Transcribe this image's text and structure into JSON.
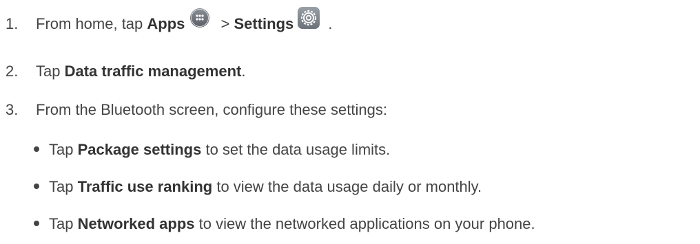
{
  "steps": [
    {
      "number": "1.",
      "prefix": "From home, tap ",
      "bold1": "Apps",
      "middle": " > ",
      "bold2": "Settings",
      "suffix": " ."
    },
    {
      "number": "2.",
      "prefix": "Tap ",
      "bold": "Data traffic management",
      "suffix": "."
    },
    {
      "number": "3.",
      "text": "From the Bluetooth screen, configure these settings:"
    }
  ],
  "bullets": [
    {
      "prefix": "Tap ",
      "bold": "Package settings",
      "suffix": " to set the data usage limits."
    },
    {
      "prefix": "Tap ",
      "bold": "Traffic use ranking",
      "suffix": " to view the data usage daily or monthly."
    },
    {
      "prefix": "Tap ",
      "bold": "Networked apps",
      "suffix": " to view the networked applications on your phone."
    }
  ],
  "icons": {
    "apps": "apps-grid-icon",
    "settings": "gear-icon"
  }
}
